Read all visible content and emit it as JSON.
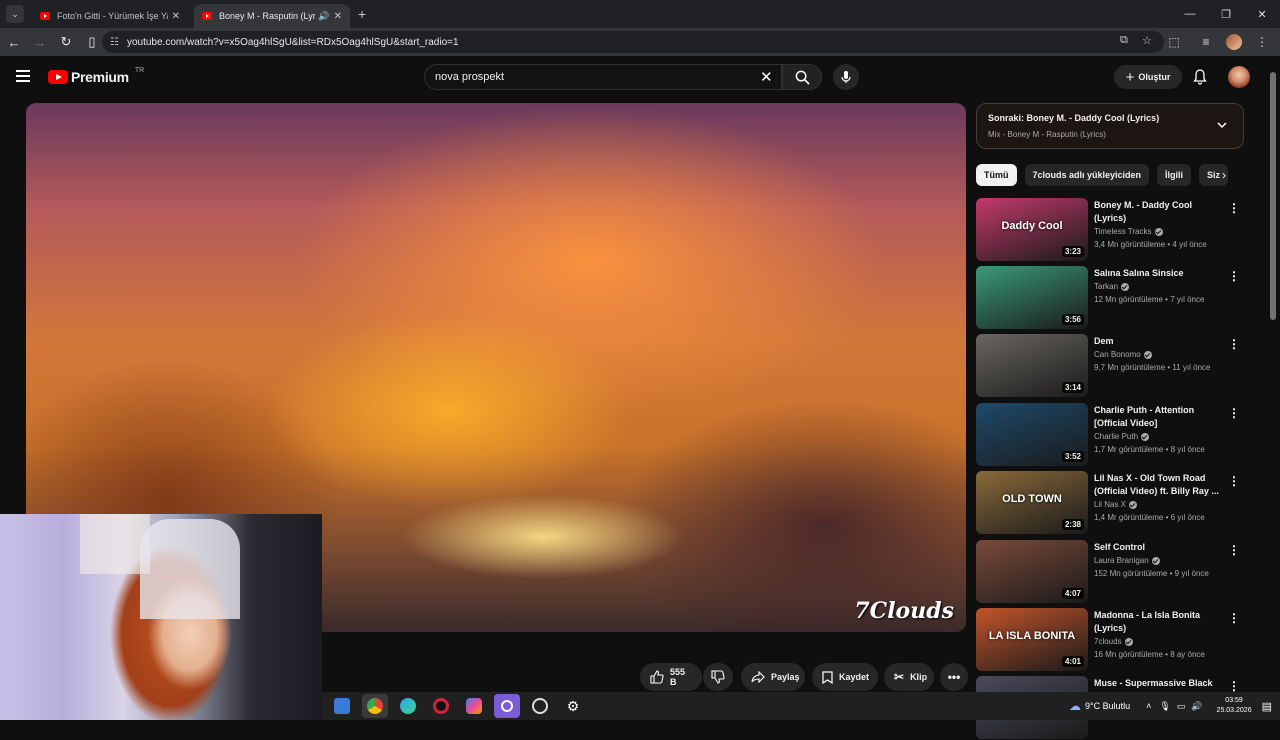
{
  "browser": {
    "tabs": [
      {
        "title": "Foto'n Gitti - Yürümek İşe Yaram",
        "active": false
      },
      {
        "title": "Boney M - Rasputin (Lyrics)",
        "active": true
      }
    ],
    "url": "youtube.com/watch?v=x5Oag4hlSgU&list=RDx5Oag4hlSgU&start_radio=1"
  },
  "youtube": {
    "logo_text": "Premium",
    "logo_region": "TR",
    "search_query": "nova prospekt",
    "create_label": "Oluştur",
    "video_watermark": "7Clouds",
    "actions": {
      "like_count": "555 B",
      "share_label": "Paylaş",
      "save_label": "Kaydet",
      "clip_label": "Klip"
    },
    "up_next": {
      "title": "Sonraki: Boney M. - Daddy Cool (Lyrics)",
      "subtitle": "Mix - Boney M - Rasputin (Lyrics)"
    },
    "chips": [
      "Tümü",
      "7clouds adlı yükleyiciden",
      "İlgili",
      "Siz"
    ],
    "videos": [
      {
        "title": "Boney M. - Daddy Cool (Lyrics)",
        "channel": "Timeless Tracks",
        "views": "3,4 Mn görüntüleme",
        "age": "4 yıl önce",
        "duration": "3:23",
        "thumb_text": "Daddy Cool",
        "accent": "#c23a6a"
      },
      {
        "title": "Salına Salına Sinsice",
        "channel": "Tarkan",
        "views": "12 Mn görüntüleme",
        "age": "7 yıl önce",
        "duration": "3:56",
        "thumb_text": "",
        "accent": "#3a9a7a"
      },
      {
        "title": "Dem",
        "channel": "Can Bonomo",
        "views": "9,7 Mn görüntüleme",
        "age": "11 yıl önce",
        "duration": "3:14",
        "thumb_text": "",
        "accent": "#6a6660"
      },
      {
        "title": "Charlie Puth - Attention [Official Video]",
        "channel": "Charlie Puth",
        "views": "1,7 Mr görüntüleme",
        "age": "8 yıl önce",
        "duration": "3:52",
        "thumb_text": "",
        "accent": "#1e4a6a"
      },
      {
        "title": "Lil Nas X - Old Town Road (Official Video) ft. Billy Ray ...",
        "channel": "Lil Nas X",
        "views": "1,4 Mr görüntüleme",
        "age": "6 yıl önce",
        "duration": "2:38",
        "thumb_text": "OLD TOWN",
        "accent": "#8a6a3a"
      },
      {
        "title": "Self Control",
        "channel": "Laura Branigan",
        "views": "152 Mn görüntüleme",
        "age": "9 yıl önce",
        "duration": "4:07",
        "thumb_text": "",
        "accent": "#7a4a3a"
      },
      {
        "title": "Madonna - La Isla Bonita (Lyrics)",
        "channel": "7clouds",
        "views": "16 Mn görüntüleme",
        "age": "8 ay önce",
        "duration": "4:01",
        "thumb_text": "LA ISLA BONITA",
        "accent": "#c2542a"
      },
      {
        "title": "Muse - Supermassive Black",
        "channel": "",
        "views": "",
        "age": "",
        "duration": "",
        "thumb_text": "",
        "accent": "#4a4a5a"
      }
    ]
  },
  "taskbar": {
    "weather": "9°C  Bulutlu",
    "time": "03:59",
    "date": "25.03.2026"
  }
}
